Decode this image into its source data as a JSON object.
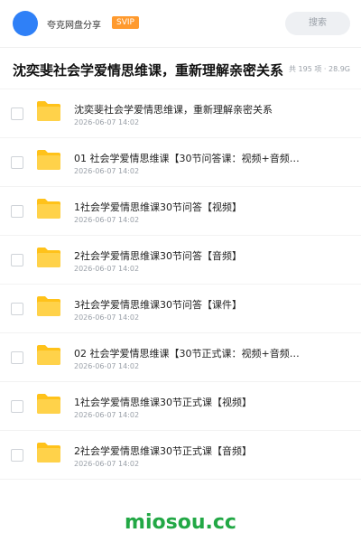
{
  "header": {
    "app_name": "夸克网盘分享",
    "vip_badge": "SVIP",
    "search_label": "搜索"
  },
  "folder": {
    "title": "沈奕斐社会学爱情思维课，重新理解亲密关系",
    "meta": "共 195 项 · 28.9G"
  },
  "files": [
    {
      "name": "沈奕斐社会学爱情思维课，重新理解亲密关系",
      "date": "2026-06-07 14:02"
    },
    {
      "name": "01 社会学爱情思维课【30节问答课：视频+音频…",
      "date": "2026-06-07 14:02"
    },
    {
      "name": "1社会学爱情思维课30节问答【视频】",
      "date": "2026-06-07 14:02"
    },
    {
      "name": "2社会学爱情思维课30节问答【音频】",
      "date": "2026-06-07 14:02"
    },
    {
      "name": "3社会学爱情思维课30节问答【课件】",
      "date": "2026-06-07 14:02"
    },
    {
      "name": "02 社会学爱情思维课【30节正式课：视频+音频…",
      "date": "2026-06-07 14:02"
    },
    {
      "name": "1社会学爱情思维课30节正式课【视频】",
      "date": "2026-06-07 14:02"
    },
    {
      "name": "2社会学爱情思维课30节正式课【音频】",
      "date": "2026-06-07 14:02"
    }
  ],
  "icons": {
    "folder": "folder-icon",
    "checkbox": "checkbox"
  },
  "colors": {
    "accent": "#2f80f7",
    "vip": "#ff9a2e",
    "folder": "#ffc21a",
    "watermark": "#22a845"
  },
  "watermark": "miosou.cc"
}
